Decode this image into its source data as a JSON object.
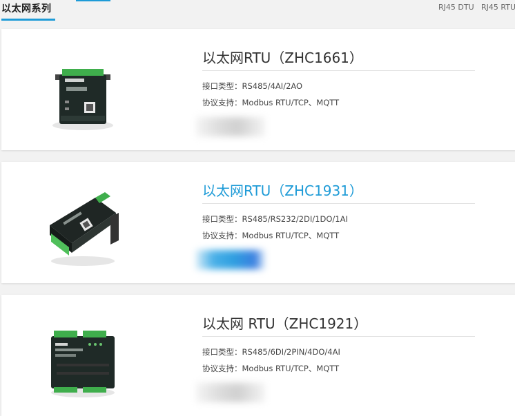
{
  "header": {
    "series_title": "以太网系列",
    "links": [
      "RJ45 DTU",
      "RJ45 RTU"
    ]
  },
  "products": [
    {
      "title": "以太网RTU（ZHC1661）",
      "interface": "接口类型：RS485/4AI/2AO",
      "protocol": "协议支持：Modbus RTU/TCP、MQTT",
      "image_icon": "zhc1661-device-image",
      "blurred_button_color": "#d9d9d9",
      "active": false
    },
    {
      "title": "以太网RTU（ZHC1931）",
      "interface": "接口类型：RS485/RS232/2DI/1DO/1AI",
      "protocol": "协议支持：Modbus RTU/TCP、MQTT",
      "image_icon": "zhc1931-device-image",
      "blurred_button_color": "#2f9fe0",
      "active": true
    },
    {
      "title": "以太网 RTU（ZHC1921）",
      "interface": "接口类型：RS485/6DI/2PIN/4DO/4AI",
      "protocol": "协议支持：Modbus RTU/TCP、MQTT",
      "image_icon": "zhc1921-device-image",
      "blurred_button_color": "#d9d9d9",
      "active": false
    }
  ],
  "colors": {
    "accent": "#1e9bd7",
    "background": "#f2f2f2",
    "card": "#ffffff"
  }
}
